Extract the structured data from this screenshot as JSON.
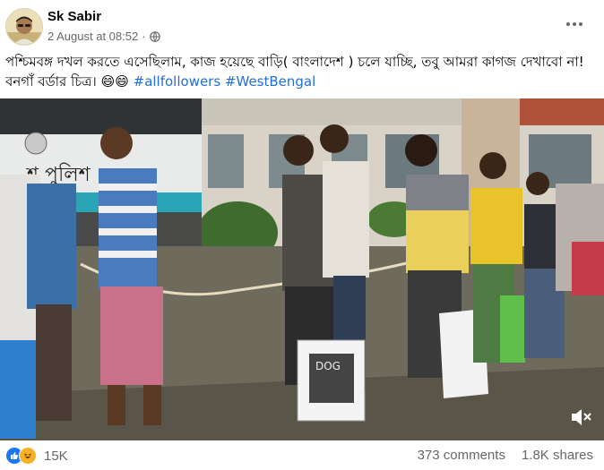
{
  "post": {
    "author": "Sk Sabir",
    "timestamp": "2 August at 08:52",
    "separator": "·",
    "caption": "পশ্চিমবঙ্গ দখল করতে এসেছিলাম, কাজ হয়েছে বাড়ি( বাংলাদেশ ) চলে যাচ্ছি, তবু আমরা কাগজ দেখাবো না! বনগাঁ বর্ডার চিত্র।",
    "emoji": "😄😄",
    "hashtags": "#allfollowers #WestBengal",
    "audience_icon": "globe-icon",
    "more_icon": "more-options-icon"
  },
  "video": {
    "bus_text": "শ পুলিশ",
    "bag_text": "DOG",
    "mute_icon": "volume-muted-icon"
  },
  "footer": {
    "reaction_count": "15K",
    "comments": "373 comments",
    "shares": "1.8K shares"
  },
  "colors": {
    "hashtag": "#216fdb",
    "meta_text": "#65676b",
    "like_blue": "#1877f2",
    "haha_yellow": "#f7b125"
  }
}
